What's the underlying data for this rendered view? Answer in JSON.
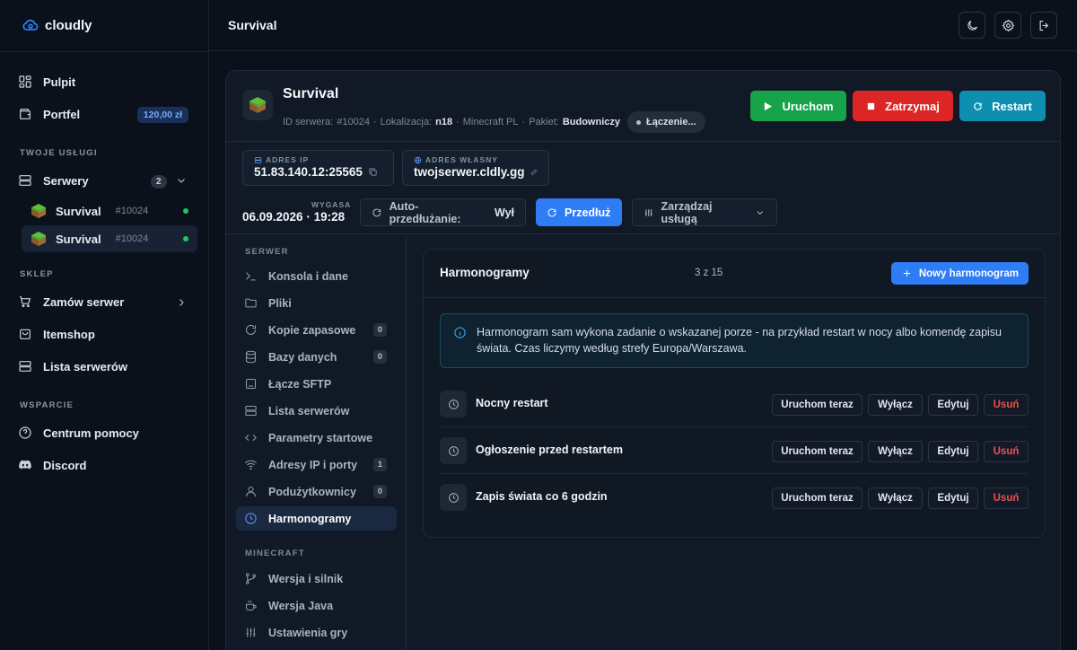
{
  "brand": "cloudly",
  "sidebar": {
    "pulpit": "Pulpit",
    "portfel": "Portfel",
    "portfel_balance": "120,00 zł",
    "section_services": "TWOJE USŁUGI",
    "servers": "Serwery",
    "servers_count": "2",
    "server_items": [
      {
        "name": "Survival",
        "id": "#10024"
      },
      {
        "name": "Survival",
        "id": "#10024"
      }
    ],
    "section_shop": "SKLEP",
    "order": "Zamów serwer",
    "itemshop": "Itemshop",
    "server_list": "Lista serwerów",
    "section_support": "WSPARCIE",
    "help": "Centrum pomocy",
    "discord": "Discord"
  },
  "topbar": {
    "title": "Survival"
  },
  "server": {
    "title": "Survival",
    "meta_id_label": "ID serwera:",
    "meta_id": "#10024",
    "meta_loc_label": "Lokalizacja:",
    "meta_loc": "n18",
    "meta_region": "Minecraft PL",
    "meta_pkg_label": "Pakiet:",
    "meta_pkg": "Budowniczy",
    "status": "Łączenie...",
    "start": "Uruchom",
    "stop": "Zatrzymaj",
    "restart": "Restart",
    "ip_label": "ADRES IP",
    "ip": "51.83.140.12:25565",
    "domain_label": "ADRES WŁASNY",
    "domain": "twojserwer.cldly.gg",
    "expires_label": "WYGASA",
    "expires": "06.09.2026 · 19:28",
    "auto_label": "Auto-przedłużanie:",
    "auto_value": "Wył",
    "extend": "Przedłuż",
    "manage": "Zarządzaj usługą"
  },
  "subnav": {
    "section_server": "SERWER",
    "items": [
      {
        "label": "Konsola i dane",
        "count": ""
      },
      {
        "label": "Pliki",
        "count": ""
      },
      {
        "label": "Kopie zapasowe",
        "count": "0"
      },
      {
        "label": "Bazy danych",
        "count": "0"
      },
      {
        "label": "Łącze SFTP",
        "count": ""
      },
      {
        "label": "Lista serwerów",
        "count": ""
      },
      {
        "label": "Parametry startowe",
        "count": ""
      },
      {
        "label": "Adresy IP i porty",
        "count": "1"
      },
      {
        "label": "Podużytkownicy",
        "count": "0"
      },
      {
        "label": "Harmonogramy",
        "count": ""
      }
    ],
    "section_minecraft": "MINECRAFT",
    "mc_items": [
      {
        "label": "Wersja i silnik"
      },
      {
        "label": "Wersja Java"
      },
      {
        "label": "Ustawienia gry"
      }
    ]
  },
  "schedules": {
    "title": "Harmonogramy",
    "count": "3 z 15",
    "new_button": "Nowy harmonogram",
    "info": "Harmonogram sam wykona zadanie o wskazanej porze - na przykład restart w nocy albo komendę zapisu świata. Czas liczymy według strefy Europa/Warszawa.",
    "rows": [
      {
        "name": "Nocny restart"
      },
      {
        "name": "Ogłoszenie przed restartem"
      },
      {
        "name": "Zapis świata co 6 godzin"
      }
    ],
    "run_now": "Uruchom teraz",
    "disable": "Wyłącz",
    "edit": "Edytuj",
    "delete": "Usuń"
  },
  "colors": {
    "accent_blue": "#2e7cf6",
    "start_green": "#16a34a",
    "stop_red": "#dc2626",
    "restart_teal": "#0e8fb0"
  }
}
